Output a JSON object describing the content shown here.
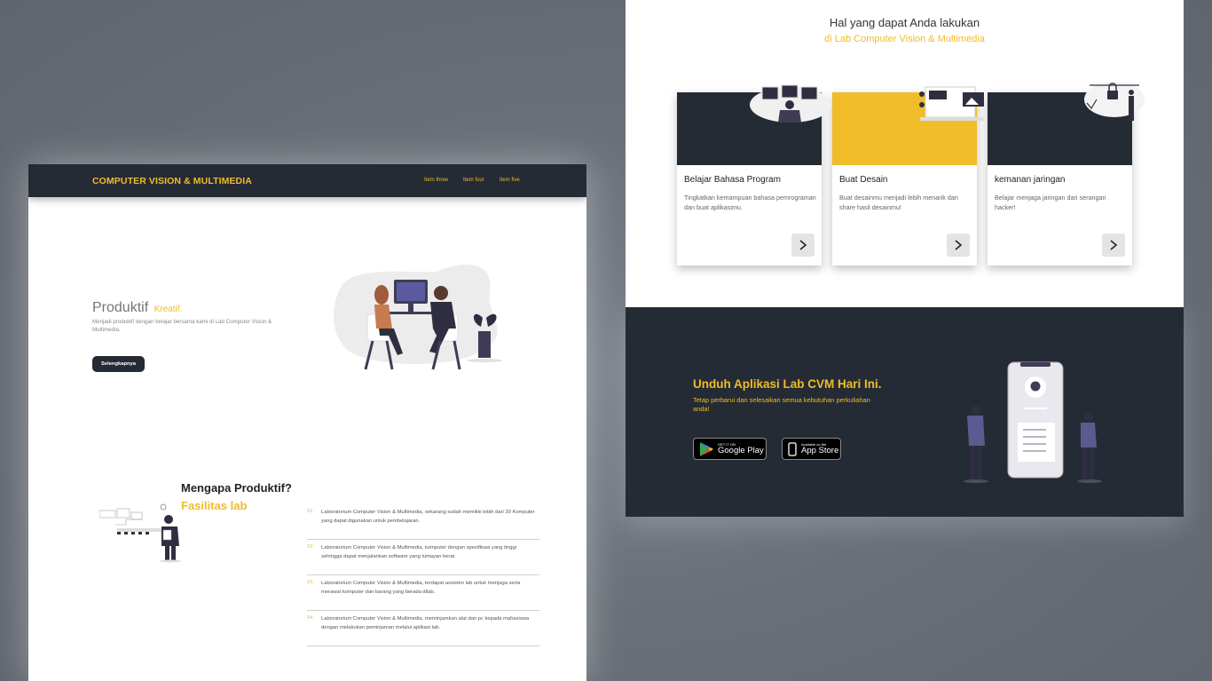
{
  "landing": {
    "brand": "COMPUTER VISION & MULTIMEDIA",
    "nav": [
      "Item three",
      "Item four",
      "Item five"
    ],
    "hero": {
      "title": "Produktif",
      "accent": "Kreatif.",
      "description": "Menjadi produktif dengan belajar bersama kami di Lab Computer Vision & Multimedia.",
      "button": "Selengkapnya"
    },
    "why": {
      "title": "Mengapa Produktif?",
      "subtitle": "Fasilitas lab",
      "items": [
        {
          "num": "01.",
          "text": "Laboratorium Computer Vision & Multimedia, sekarang sudah memiliki lebih dari 30 Komputer yang dapat digunakan untuk pembelajaran."
        },
        {
          "num": "02.",
          "text": "Laboratorium Computer Vision & Multimedia, komputer dengan spesifikasi yang tinggi sehingga dapat menjalankan software yang lumayan berat."
        },
        {
          "num": "03.",
          "text": "Laboratorium Computer Vision & Multimedia, terdapat assisten lab untuk menjaga serta merawat komputer dan barang yang berada dilab."
        },
        {
          "num": "04.",
          "text": "Laboratorium Computer Vision & Multimedia, meminjamkan alat dan pc kepada mahasiswa dengan melakukan peminjaman melalui aplikasi lab."
        }
      ]
    }
  },
  "services": {
    "title": "Hal yang dapat Anda lakukan",
    "subtitle": "di Lab Computer Vision & Multimedia",
    "cards": [
      {
        "title": "Belajar Bahasa Program",
        "desc": "Tingkatkan kemampuan bahasa pemrograman dan buat aplikasimu.",
        "image_color": "#252b34"
      },
      {
        "title": "Buat Desain",
        "desc": "Buat desainmu menjadi lebih menarik dan share hasil desainmu!",
        "image_color": "#f0bc29"
      },
      {
        "title": "kemanan jaringan",
        "desc": "Belajar menjaga jaringan dari serangan hacker!",
        "image_color": "#252b34"
      }
    ]
  },
  "download": {
    "title": "Unduh Aplikasi Lab CVM Hari Ini.",
    "desc": "Tetap perbarui dan selesaikan semua kebutuhan perkuliahan anda!",
    "google": {
      "small": "GET IT ON",
      "big": "Google Play"
    },
    "apple": {
      "small": "Available on the",
      "big": "App Store"
    }
  },
  "colors": {
    "accent": "#f0bc29",
    "dark": "#252b34"
  }
}
